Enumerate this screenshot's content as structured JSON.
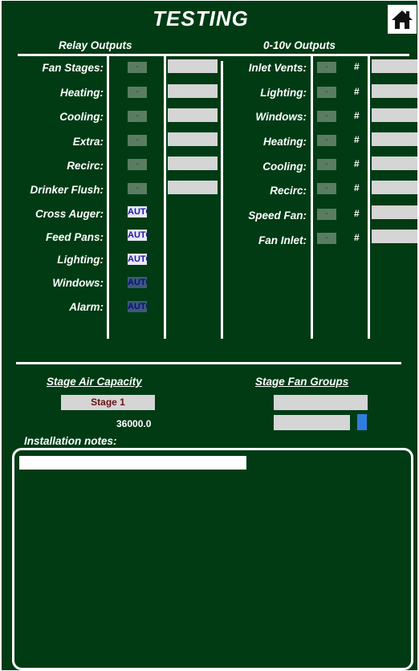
{
  "header": {
    "title": "TESTING",
    "home_icon": "home-icon"
  },
  "relay": {
    "heading": "Relay Outputs",
    "rows": [
      {
        "label": "Fan Stages:",
        "state": "-"
      },
      {
        "label": "Heating:",
        "state": "-"
      },
      {
        "label": "Cooling:",
        "state": "-"
      },
      {
        "label": "Extra:",
        "state": "-"
      },
      {
        "label": "Recirc:",
        "state": "-"
      },
      {
        "label": "Drinker Flush:",
        "state": "-"
      },
      {
        "label": "Cross Auger:",
        "state": "AUTO"
      },
      {
        "label": "Feed Pans:",
        "state": "AUTO"
      },
      {
        "label": "Lighting:",
        "state": "AUTO"
      },
      {
        "label": "Windows:",
        "state": "AUTO"
      },
      {
        "label": "Alarm:",
        "state": "AUTO"
      }
    ]
  },
  "analog": {
    "heading": "0-10v Outputs",
    "rows": [
      {
        "label": "Inlet Vents:",
        "state": "-",
        "hash": "#"
      },
      {
        "label": "Lighting:",
        "state": "-",
        "hash": "#"
      },
      {
        "label": "Windows:",
        "state": "-",
        "hash": "#"
      },
      {
        "label": "Heating:",
        "state": "-",
        "hash": "#"
      },
      {
        "label": "Cooling:",
        "state": "-",
        "hash": "#"
      },
      {
        "label": "Recirc:",
        "state": "-",
        "hash": "#"
      },
      {
        "label": "Speed Fan:",
        "state": "-",
        "hash": "#"
      },
      {
        "label": "Fan Inlet:",
        "state": "-",
        "hash": "#"
      }
    ]
  },
  "stage_air": {
    "heading": "Stage Air Capacity",
    "stage_label": "Stage 1",
    "value": "36000.0"
  },
  "fan_groups": {
    "heading": "Stage Fan Groups"
  },
  "notes": {
    "label": "Installation notes:"
  },
  "colors": {
    "background": "#003b14",
    "accent_blue": "#2f7de1",
    "auto_text": "#1a1aa8"
  }
}
